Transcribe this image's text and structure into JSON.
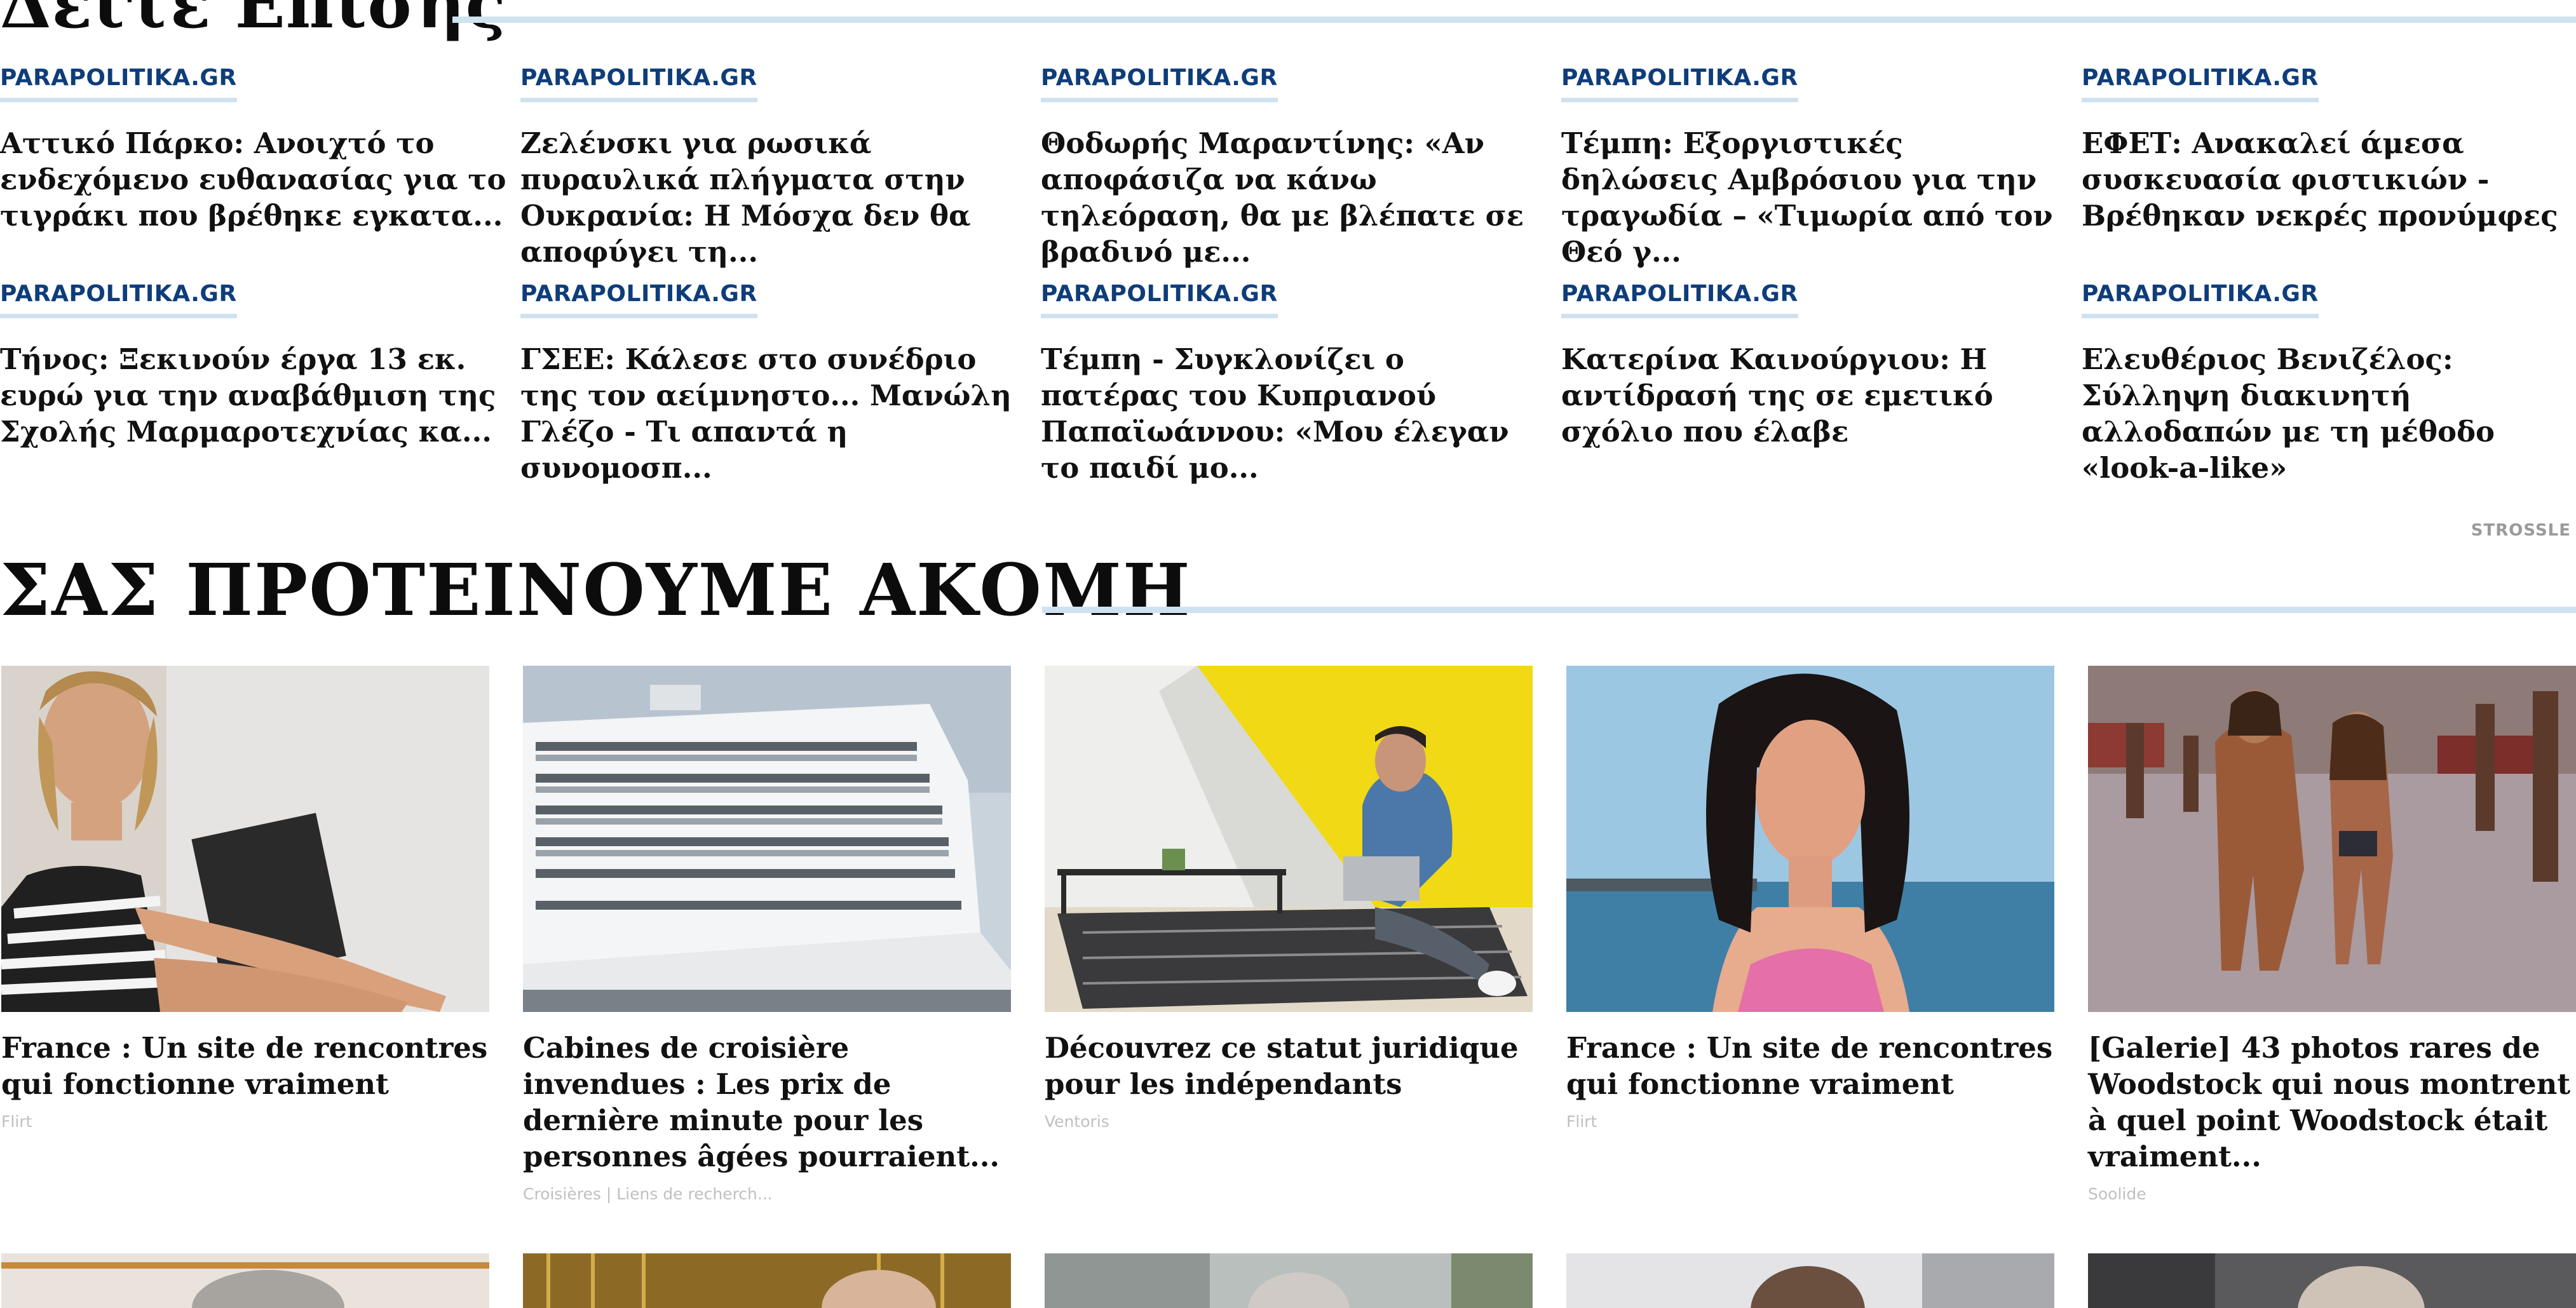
{
  "see_also": {
    "title": "Δείτε Επίσης",
    "items": [
      {
        "source": "PARAPOLITIKA.GR",
        "title": "Αττικό Πάρκο: Ανοιχτό το ενδεχόμενο ευθανασίας για το τιγράκι που βρέθηκε εγκατα..."
      },
      {
        "source": "PARAPOLITIKA.GR",
        "title": "Ζελένσκι για ρωσικά πυραυλικά πλήγματα στην Ουκρανία: Η Μόσχα δεν θα αποφύγει τη..."
      },
      {
        "source": "PARAPOLITIKA.GR",
        "title": "Θοδωρής Μαραντίνης: «Αν αποφάσιζα να κάνω τηλεόραση, θα με βλέπατε σε βραδινό με..."
      },
      {
        "source": "PARAPOLITIKA.GR",
        "title": "Τέμπη: Εξοργιστικές δηλώσεις Αμβρόσιου για την τραγωδία – «Τιμωρία από τον Θεό γ..."
      },
      {
        "source": "PARAPOLITIKA.GR",
        "title": "ΕΦΕΤ: Ανακαλεί άμεσα συσκευασία φιστικιών - Βρέθηκαν νεκρές προνύμφες"
      },
      {
        "source": "PARAPOLITIKA.GR",
        "title": "Τήνος: Ξεκινούν έργα 13 εκ. ευρώ για την αναβάθμιση της Σχολής Μαρμαροτεχνίας κα..."
      },
      {
        "source": "PARAPOLITIKA.GR",
        "title": "ΓΣΕΕ: Κάλεσε στο συνέδριο της τον αείμνηστο... Μανώλη Γλέζο - Τι απαντά η συνομοσπ..."
      },
      {
        "source": "PARAPOLITIKA.GR",
        "title": "Τέμπη - Συγκλονίζει ο πατέρας του Κυπριανού Παπαϊωάννου: «Μου έλεγαν το παιδί μο..."
      },
      {
        "source": "PARAPOLITIKA.GR",
        "title": "Κατερίνα Καινούργιου: Η αντίδρασή της σε εμετικό σχόλιο που έλαβε"
      },
      {
        "source": "PARAPOLITIKA.GR",
        "title": "Ελευθέριος Βενιζέλος: Σύλληψη διακινητή αλλοδαπών με τη μέθοδο «look-a-like»"
      }
    ]
  },
  "recommend": {
    "title": "ΣΑΣ ΠΡΟΤΕΙΝΟΥΜΕ ΑΚΟΜΗ",
    "sponsor": "STROSSLE",
    "cards": [
      {
        "title": "France : Un site de rencontres qui fonctionne vraiment",
        "source": "Flirt",
        "image": "woman-seated-photo"
      },
      {
        "title": "Cabines de croisière invendues : Les prix de dernière minute pour les personnes âgées pourraient...",
        "source": "Croisières | Liens de recherch...",
        "image": "cruise-ship-photo"
      },
      {
        "title": "Découvrez ce statut juridique pour les indépendants",
        "source": "Ventoris",
        "image": "man-laptop-photo"
      },
      {
        "title": "France : Un site de rencontres qui fonctionne vraiment",
        "source": "Flirt",
        "image": "woman-portrait-photo"
      },
      {
        "title": "[Galerie] 43 photos rares de Woodstock qui nous montrent à quel point Woodstock était vraiment...",
        "source": "Soolide",
        "image": "woodstock-crowd-photo"
      }
    ]
  }
}
